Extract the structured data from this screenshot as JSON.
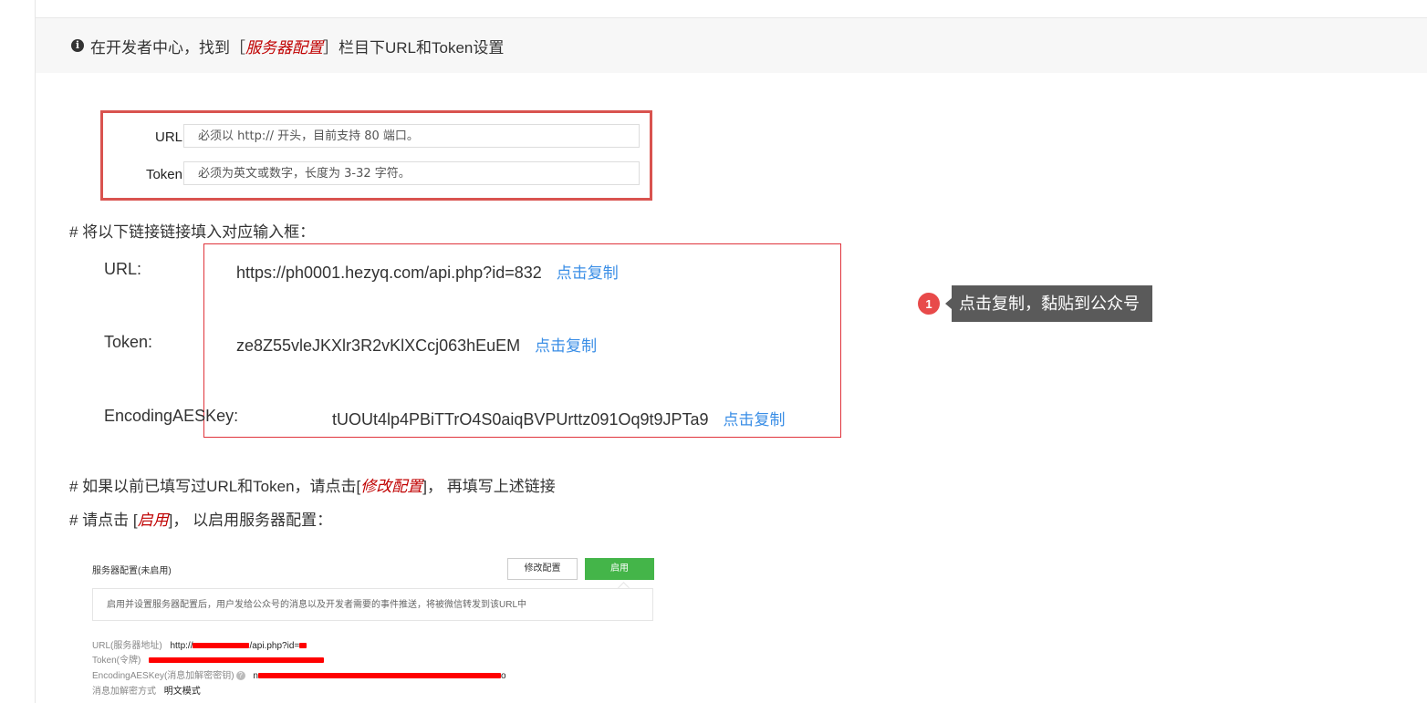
{
  "notice": {
    "prefix": "在开发者中心，找到［",
    "emphasis": "服务器配置",
    "suffix": "］栏目下URL和Token设置"
  },
  "form_screenshot": {
    "url_label": "URL",
    "url_placeholder": "必须以 http:// 开头，目前支持 80 端口。",
    "token_label": "Token",
    "token_placeholder": "必须为英文或数字，长度为 3-32 字符。"
  },
  "instruction1": "# 将以下链接链接填入对应输入框：",
  "fields": {
    "url_label": "URL:",
    "url_value": "https://ph0001.hezyq.com/api.php?id=832",
    "token_label": "Token:",
    "token_value": "ze8Z55vleJKXlr3R2vKlXCcj063hEuEM",
    "aes_label": "EncodingAESKey:",
    "aes_value": "tUOUt4lp4PBiTTrO4S0aiqBVPUrttz091Oq9t9JPTa9",
    "copy_label": "点击复制"
  },
  "tooltip": {
    "badge": "1",
    "text": "点击复制，黏贴到公众号"
  },
  "instruction2": {
    "prefix": "# 如果以前已填写过URL和Token，请点击[",
    "emphasis": "修改配置",
    "suffix": "]， 再填写上述链接"
  },
  "instruction3": {
    "prefix": "# 请点击 [",
    "emphasis": "启用",
    "suffix": "]， 以启用服务器配置："
  },
  "server_screenshot": {
    "title": "服务器配置(未启用)",
    "modify_button": "修改配置",
    "enable_button": "启用",
    "description": "启用并设置服务器配置后，用户发给公众号的消息以及开发者需要的事件推送，将被微信转发到该URL中",
    "url_label": "URL(服务器地址)",
    "url_value_prefix": "http://",
    "url_value_mid": "/api.php?id=",
    "token_label": "Token(令牌)",
    "aes_label": "EncodingAESKey(消息加解密密钥)",
    "aes_prefix": "n",
    "aes_suffix": "o",
    "mode_label": "消息加解密方式",
    "mode_value": "明文模式"
  },
  "colors": {
    "accent_link": "#3a8ee6",
    "emphasis_red": "#c00000",
    "box_border": "#e0343c",
    "enable_green": "#44b549",
    "redaction": "#ff0000"
  }
}
